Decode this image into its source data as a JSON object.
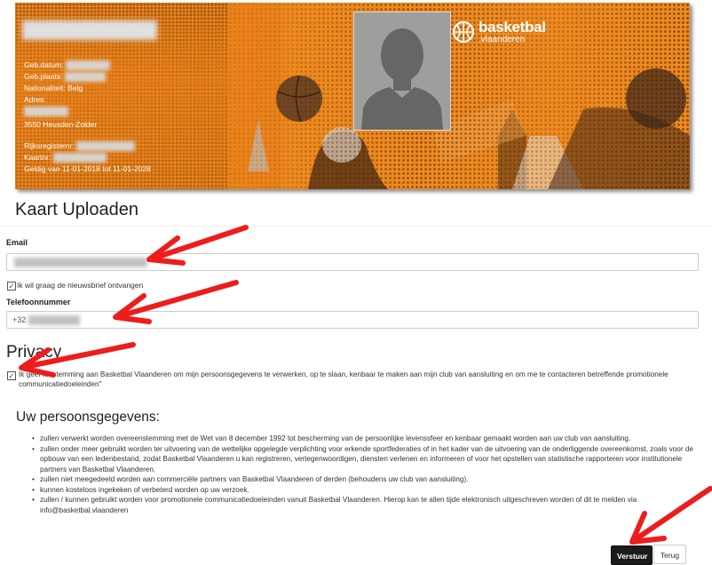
{
  "card": {
    "birthdate_label": "Geb.datum:",
    "birthplace_label": "Geb.plaats:",
    "nationality_label": "Nationaliteit:",
    "nationality_value": "Belg",
    "address_label": "Adres:",
    "city": "3550 Heusden-Zolder",
    "national_register_label": "Rijksregisternr:",
    "card_number_label": "Kaartnr:",
    "validity": "Geldig van 11-01-2018 tot 11-01-2028",
    "logo_main": "basketbal",
    "logo_sub": ".vlaanderen",
    "accent_color": "#ef8a1f"
  },
  "page": {
    "title": "Kaart Uploaden"
  },
  "form": {
    "email_label": "Email",
    "email_value": "",
    "newsletter_label": "Ik wil graag de nieuwsbrief ontvangen",
    "newsletter_checked": true,
    "phone_label": "Telefoonnummer",
    "phone_value": "+32"
  },
  "privacy": {
    "heading": "Privacy",
    "consent_text": "Ik geef toestemming aan Basketbal Vlaanderen om mijn persoonsgegevens te verwerken, op te slaan, kenbaar te maken aan mijn club van aansluiting en om me te contacteren betreffende promotionele communicatiedoeleinden\"",
    "consent_checked": true
  },
  "personal_data": {
    "heading": "Uw persoonsgegevens:",
    "items": [
      "zullen verwerkt worden overeenstemming met de Wet van 8 december 1992 tot bescherming van de persoonlijke levenssfeer en kenbaar gemaakt worden aan uw club van aansluiting.",
      "zullen onder meer gebruikt worden ter uitvoering van de wettelijke opgelegde verplichting voor erkende sportfederaties of in het kader van de uitvoering van de onderliggende overeenkomst, zoals voor de opbouw van een ledenbestand, zodat Basketbal Vlaanderen u kan registreren, vertegenwoordigen, diensten verlenen en informeren of voor het opstellen van statistische rapporteren voor institutionele partners van Basketbal Vlaanderen.",
      "zullen niet meegedeeld worden aan commerciële partners van Basketbal Vlaanderen of derden (behoudens uw club van aansluiting).",
      "kunnen kosteloos ingekeken of verbeterd worden op uw verzoek.",
      "zullen / kunnen gebruikt worden voor promotionele communicatiedoeleinden vanuit Basketbal Vlaanderen. Hierop kan te allen tijde elektronisch uitgeschreven worden of dit te melden via info@basketbal.vlaanderen"
    ]
  },
  "buttons": {
    "submit": "Verstuur",
    "back": "Terug"
  },
  "annotation_color": "#ee1c1c"
}
